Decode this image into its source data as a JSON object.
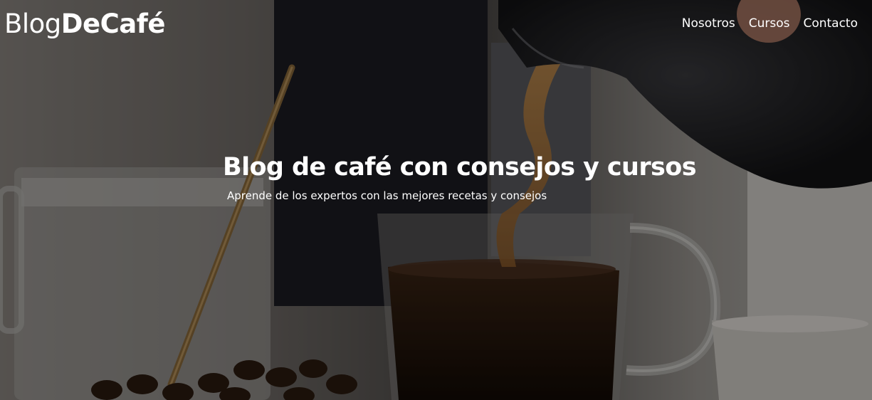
{
  "logo": {
    "part_light": "Blog",
    "part_bold": "DeCafé"
  },
  "nav": {
    "items": [
      {
        "label": "Nosotros"
      },
      {
        "label": "Cursos"
      },
      {
        "label": "Contacto"
      }
    ]
  },
  "hero": {
    "title": "Blog de café con consejos y cursos",
    "subtitle": "Aprende de los expertos con las mejores recetas y consejos"
  },
  "colors": {
    "text": "#ffffff",
    "overlay": "#000000",
    "coffee": "#2a1a10"
  }
}
